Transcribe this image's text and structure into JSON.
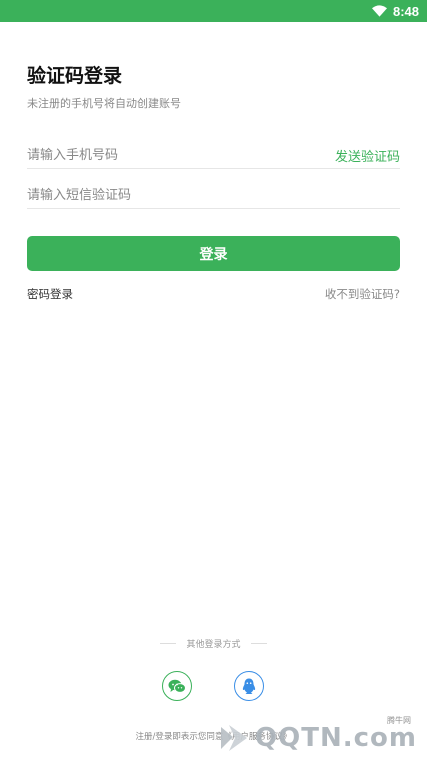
{
  "status_bar": {
    "time": "8:48"
  },
  "page": {
    "title": "验证码登录",
    "subtitle": "未注册的手机号将自动创建账号"
  },
  "form": {
    "phone_placeholder": "请输入手机号码",
    "send_code_label": "发送验证码",
    "code_placeholder": "请输入短信验证码",
    "login_button": "登录",
    "password_login": "密码登录",
    "no_code": "收不到验证码?"
  },
  "other_login": {
    "label": "其他登录方式",
    "methods": [
      "wechat-icon",
      "qq-icon"
    ]
  },
  "agreement": {
    "text": "注册/登录即表示您同意",
    "link": "《用户服务协议》"
  },
  "watermark": {
    "text": "QQTN.com",
    "small": "腾牛网"
  },
  "colors": {
    "primary": "#3bb15a",
    "qq": "#3a8ee6"
  }
}
